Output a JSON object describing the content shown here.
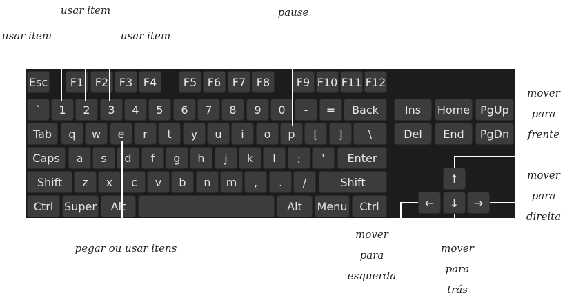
{
  "keyboard": {
    "rows": [
      [
        "Esc",
        "F1",
        "F2",
        "F3",
        "F4",
        "F5",
        "F6",
        "F7",
        "F8",
        "F9",
        "F10",
        "F11",
        "F12"
      ],
      [
        "`",
        "1",
        "2",
        "3",
        "4",
        "5",
        "6",
        "7",
        "8",
        "9",
        "0",
        "-",
        "=",
        "Back",
        "Ins",
        "Home",
        "PgUp"
      ],
      [
        "Tab",
        "q",
        "w",
        "e",
        "r",
        "t",
        "y",
        "u",
        "i",
        "o",
        "p",
        "[",
        "]",
        "\\",
        "Del",
        "End",
        "PgDn"
      ],
      [
        "Caps",
        "a",
        "s",
        "d",
        "f",
        "g",
        "h",
        "j",
        "k",
        "l",
        ";",
        "'",
        "Enter"
      ],
      [
        "Shift",
        "z",
        "x",
        "c",
        "v",
        "b",
        "n",
        "m",
        ",",
        ".",
        "/",
        "Shift"
      ],
      [
        "Ctrl",
        "Super",
        "Alt",
        "",
        "Alt",
        "Menu",
        "Ctrl"
      ]
    ],
    "arrows": {
      "up": "↑",
      "left": "←",
      "down": "↓",
      "right": "→"
    }
  },
  "annotations": {
    "user_item_1": "usar item",
    "user_item_2": "usar item",
    "user_item_3": "usar item",
    "pause": "pause",
    "pick_up": "pegar ou usar itens",
    "move_forward": [
      "mover",
      "para",
      "frente"
    ],
    "move_right": [
      "mover",
      "para",
      "direita"
    ],
    "move_left": [
      "mover",
      "para",
      "esquerda"
    ],
    "move_back": [
      "mover",
      "para",
      "trás"
    ]
  }
}
